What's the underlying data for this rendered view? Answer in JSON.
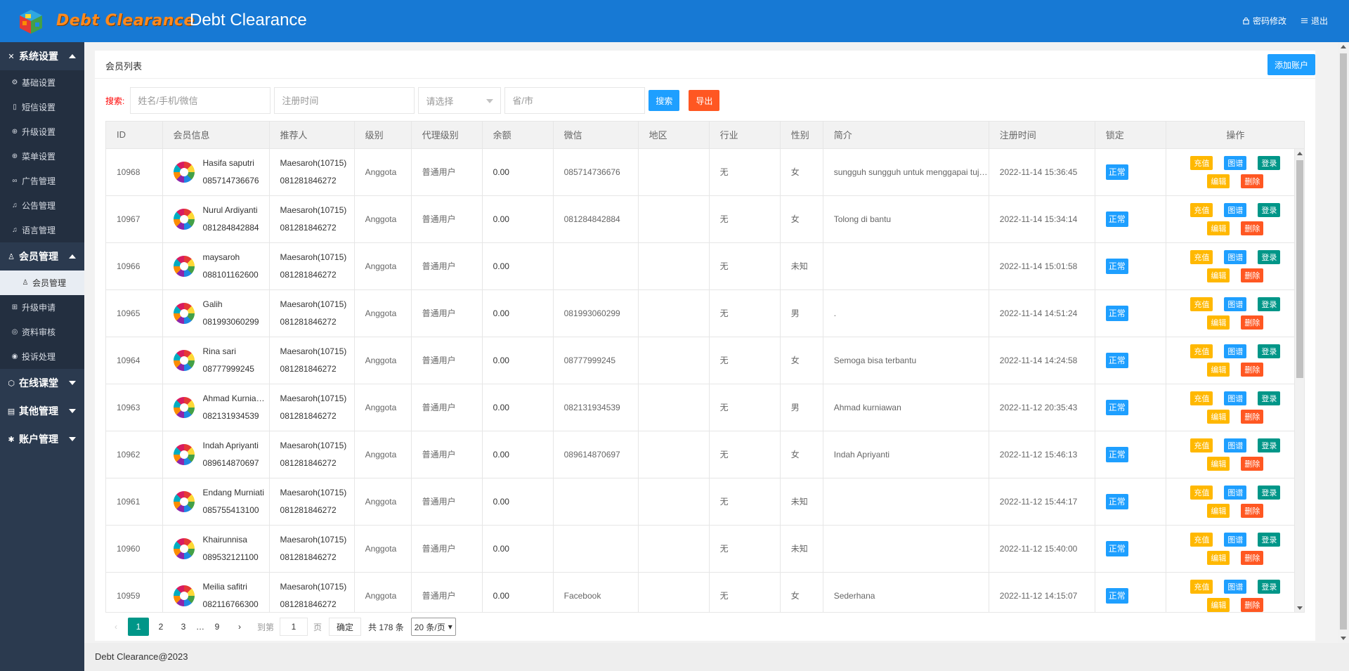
{
  "header": {
    "logo_text": "Debt Clearance",
    "title": "Debt Clearance",
    "change_password": "密码修改",
    "logout": "退出"
  },
  "sidebar": {
    "groups": [
      {
        "label": "系统设置",
        "icon": "tools-icon",
        "expanded": true,
        "items": [
          {
            "label": "基础设置",
            "icon": "gear-icon"
          },
          {
            "label": "短信设置",
            "icon": "phone-icon"
          },
          {
            "label": "升级设置",
            "icon": "upgrade-icon"
          },
          {
            "label": "菜单设置",
            "icon": "menu-icon"
          },
          {
            "label": "广告管理",
            "icon": "link-icon"
          },
          {
            "label": "公告管理",
            "icon": "bell-icon"
          },
          {
            "label": "语言管理",
            "icon": "bell-icon"
          }
        ]
      },
      {
        "label": "会员管理",
        "icon": "user-icon",
        "expanded": true,
        "items": [
          {
            "label": "会员管理",
            "icon": "user-icon",
            "active": true
          },
          {
            "label": "升级申请",
            "icon": "upgrade-icon"
          },
          {
            "label": "资料审核",
            "icon": "shield-icon"
          },
          {
            "label": "投诉处理",
            "icon": "alert-icon"
          }
        ]
      },
      {
        "label": "在线课堂",
        "icon": "cube-icon",
        "expanded": false
      },
      {
        "label": "其他管理",
        "icon": "doc-icon",
        "expanded": false
      },
      {
        "label": "账户管理",
        "icon": "gear-icon",
        "expanded": false
      }
    ]
  },
  "panel": {
    "title": "会员列表",
    "add_button": "添加账户"
  },
  "search": {
    "label": "搜索:",
    "name_placeholder": "姓名/手机/微信",
    "date_placeholder": "注册时间",
    "select_placeholder": "请选择",
    "region_placeholder": "省/市",
    "search_button": "搜索",
    "export_button": "导出"
  },
  "table": {
    "columns": [
      "ID",
      "会员信息",
      "推荐人",
      "级别",
      "代理级别",
      "余额",
      "微信",
      "地区",
      "行业",
      "性别",
      "简介",
      "注册时间",
      "锁定",
      "操作"
    ],
    "rows": [
      {
        "id": "10968",
        "name": "Hasifa saputri",
        "phone": "085714736676",
        "ref_name": "Maesaroh(10715)",
        "ref_phone": "081281846272",
        "level": "Anggota",
        "agent": "普通用户",
        "balance": "0.00",
        "wechat": "085714736676",
        "region": "",
        "industry": "无",
        "gender": "女",
        "bio": "sungguh sungguh untuk menggapai tujuan",
        "reg_time": "2022-11-14 15:36:45",
        "lock": "正常"
      },
      {
        "id": "10967",
        "name": "Nurul Ardiyanti",
        "phone": "081284842884",
        "ref_name": "Maesaroh(10715)",
        "ref_phone": "081281846272",
        "level": "Anggota",
        "agent": "普通用户",
        "balance": "0.00",
        "wechat": "081284842884",
        "region": "",
        "industry": "无",
        "gender": "女",
        "bio": "Tolong di bantu",
        "reg_time": "2022-11-14 15:34:14",
        "lock": "正常"
      },
      {
        "id": "10966",
        "name": "maysaroh",
        "phone": "088101162600",
        "ref_name": "Maesaroh(10715)",
        "ref_phone": "081281846272",
        "level": "Anggota",
        "agent": "普通用户",
        "balance": "0.00",
        "wechat": "",
        "region": "",
        "industry": "无",
        "gender": "未知",
        "bio": "",
        "reg_time": "2022-11-14 15:01:58",
        "lock": "正常"
      },
      {
        "id": "10965",
        "name": "Galih",
        "phone": "081993060299",
        "ref_name": "Maesaroh(10715)",
        "ref_phone": "081281846272",
        "level": "Anggota",
        "agent": "普通用户",
        "balance": "0.00",
        "wechat": "081993060299",
        "region": "",
        "industry": "无",
        "gender": "男",
        "bio": ".",
        "reg_time": "2022-11-14 14:51:24",
        "lock": "正常"
      },
      {
        "id": "10964",
        "name": "Rina sari",
        "phone": "08777999245",
        "ref_name": "Maesaroh(10715)",
        "ref_phone": "081281846272",
        "level": "Anggota",
        "agent": "普通用户",
        "balance": "0.00",
        "wechat": "08777999245",
        "region": "",
        "industry": "无",
        "gender": "女",
        "bio": "Semoga bisa terbantu",
        "reg_time": "2022-11-14 14:24:58",
        "lock": "正常"
      },
      {
        "id": "10963",
        "name": "Ahmad Kurniawan",
        "phone": "082131934539",
        "ref_name": "Maesaroh(10715)",
        "ref_phone": "081281846272",
        "level": "Anggota",
        "agent": "普通用户",
        "balance": "0.00",
        "wechat": "082131934539",
        "region": "",
        "industry": "无",
        "gender": "男",
        "bio": "Ahmad kurniawan",
        "reg_time": "2022-11-12 20:35:43",
        "lock": "正常"
      },
      {
        "id": "10962",
        "name": "Indah Apriyanti",
        "phone": "089614870697",
        "ref_name": "Maesaroh(10715)",
        "ref_phone": "081281846272",
        "level": "Anggota",
        "agent": "普通用户",
        "balance": "0.00",
        "wechat": "089614870697",
        "region": "",
        "industry": "无",
        "gender": "女",
        "bio": "Indah Apriyanti",
        "reg_time": "2022-11-12 15:46:13",
        "lock": "正常"
      },
      {
        "id": "10961",
        "name": "Endang Murniati",
        "phone": "085755413100",
        "ref_name": "Maesaroh(10715)",
        "ref_phone": "081281846272",
        "level": "Anggota",
        "agent": "普通用户",
        "balance": "0.00",
        "wechat": "",
        "region": "",
        "industry": "无",
        "gender": "未知",
        "bio": "",
        "reg_time": "2022-11-12 15:44:17",
        "lock": "正常"
      },
      {
        "id": "10960",
        "name": "Khairunnisa",
        "phone": "089532121100",
        "ref_name": "Maesaroh(10715)",
        "ref_phone": "081281846272",
        "level": "Anggota",
        "agent": "普通用户",
        "balance": "0.00",
        "wechat": "",
        "region": "",
        "industry": "无",
        "gender": "未知",
        "bio": "",
        "reg_time": "2022-11-12 15:40:00",
        "lock": "正常"
      },
      {
        "id": "10959",
        "name": "Meilia safitri",
        "phone": "082116766300",
        "ref_name": "Maesaroh(10715)",
        "ref_phone": "081281846272",
        "level": "Anggota",
        "agent": "普通用户",
        "balance": "0.00",
        "wechat": "Facebook",
        "region": "",
        "industry": "无",
        "gender": "女",
        "bio": "Sederhana",
        "reg_time": "2022-11-12 14:15:07",
        "lock": "正常"
      }
    ],
    "actions": {
      "recharge": "充值",
      "graph": "图谱",
      "login": "登录",
      "edit": "编辑",
      "delete": "删除"
    }
  },
  "pagination": {
    "pages": [
      "1",
      "2",
      "3",
      "…",
      "9"
    ],
    "current": "1",
    "goto_label": "到第",
    "page_value": "1",
    "page_suffix": "页",
    "confirm": "确定",
    "total": "共 178 条",
    "page_size": "20 条/页"
  },
  "footer": {
    "text": "Debt Clearance@2023"
  },
  "colors": {
    "header": "#1779d4",
    "sidebar": "#2b3a4f",
    "primary": "#1e9fff",
    "danger": "#ff5722",
    "success": "#009688",
    "warning": "#ffb800"
  }
}
